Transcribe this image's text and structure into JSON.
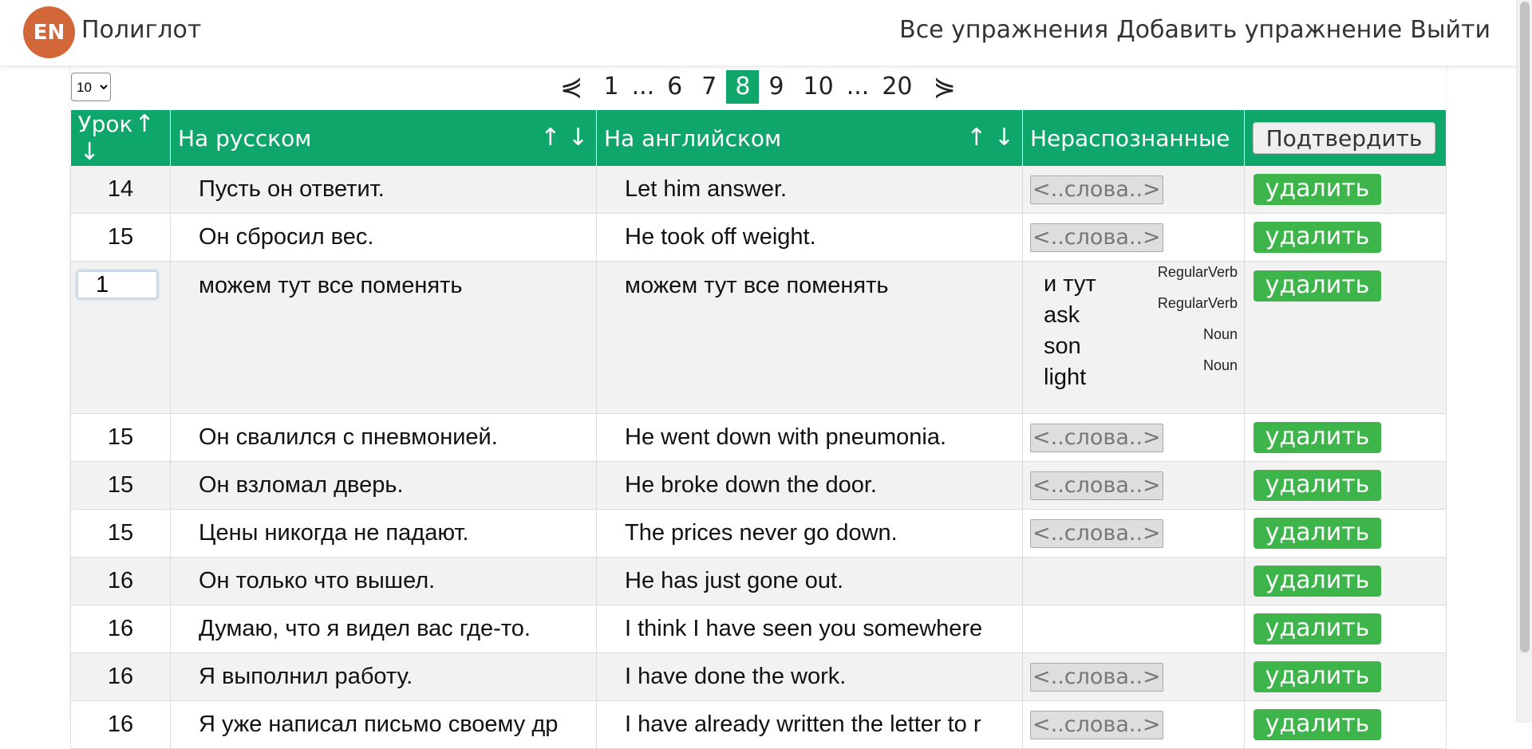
{
  "header": {
    "logo": "EN",
    "app_name": "Полиглот",
    "nav": [
      "Все упражнения",
      "Добавить упражнение",
      "Выйти"
    ]
  },
  "page_size": {
    "selected": "10"
  },
  "pager": {
    "prev": "⋞",
    "next": "⋟",
    "items": [
      "1",
      "...",
      "6",
      "7",
      "8",
      "9",
      "10",
      "...",
      "20"
    ],
    "active": "8"
  },
  "table": {
    "headers": {
      "lesson": "Урок",
      "ru": "На русском",
      "en": "На английском",
      "unknown": "Нераспознанные",
      "confirm": "Подтвердить",
      "sort_up": "↑",
      "sort_down": "↓"
    },
    "words_placeholder": "<..слова..>",
    "delete_label": "удалить",
    "rows": [
      {
        "lesson": "14",
        "ru": "Пусть он ответит.",
        "en": "Let him answer.",
        "words": true
      },
      {
        "lesson": "15",
        "ru": "Он сбросил вес.",
        "en": "He took off weight.",
        "words": true
      },
      {
        "lesson": "1",
        "ru": "можем тут все поменять",
        "en": "можем тут все поменять",
        "editing": true,
        "word_list": [
          {
            "word": "и тут",
            "pos": "RegularVerb"
          },
          {
            "word": "ask",
            "pos": "RegularVerb"
          },
          {
            "word": "son",
            "pos": "Noun"
          },
          {
            "word": "light",
            "pos": "Noun"
          }
        ]
      },
      {
        "lesson": "15",
        "ru": "Он свалился с пневмонией.",
        "en": "He went down with pneumonia.",
        "words": true
      },
      {
        "lesson": "15",
        "ru": "Он взломал дверь.",
        "en": "He broke down the door.",
        "words": true
      },
      {
        "lesson": "15",
        "ru": "Цены никогда не падают.",
        "en": "The prices never go down.",
        "words": true
      },
      {
        "lesson": "16",
        "ru": "Он только что вышел.",
        "en": "He has just gone out.",
        "words": false
      },
      {
        "lesson": "16",
        "ru": "Думаю, что я видел вас где-то.",
        "en": "I think I have seen you somewhere",
        "words": false
      },
      {
        "lesson": "16",
        "ru": "Я выполнил работу.",
        "en": "I have done the work.",
        "words": true
      },
      {
        "lesson": "16",
        "ru": "Я уже написал письмо своему др",
        "en": "I have already written the letter to r",
        "words": true
      }
    ]
  },
  "colors": {
    "accent_green": "#0fa66c",
    "delete_green": "#3db54a",
    "logo_orange": "#d2673a"
  },
  "icons": {
    "sort": "sort-arrows-icon",
    "select_chevron": "chevron-down-icon"
  }
}
